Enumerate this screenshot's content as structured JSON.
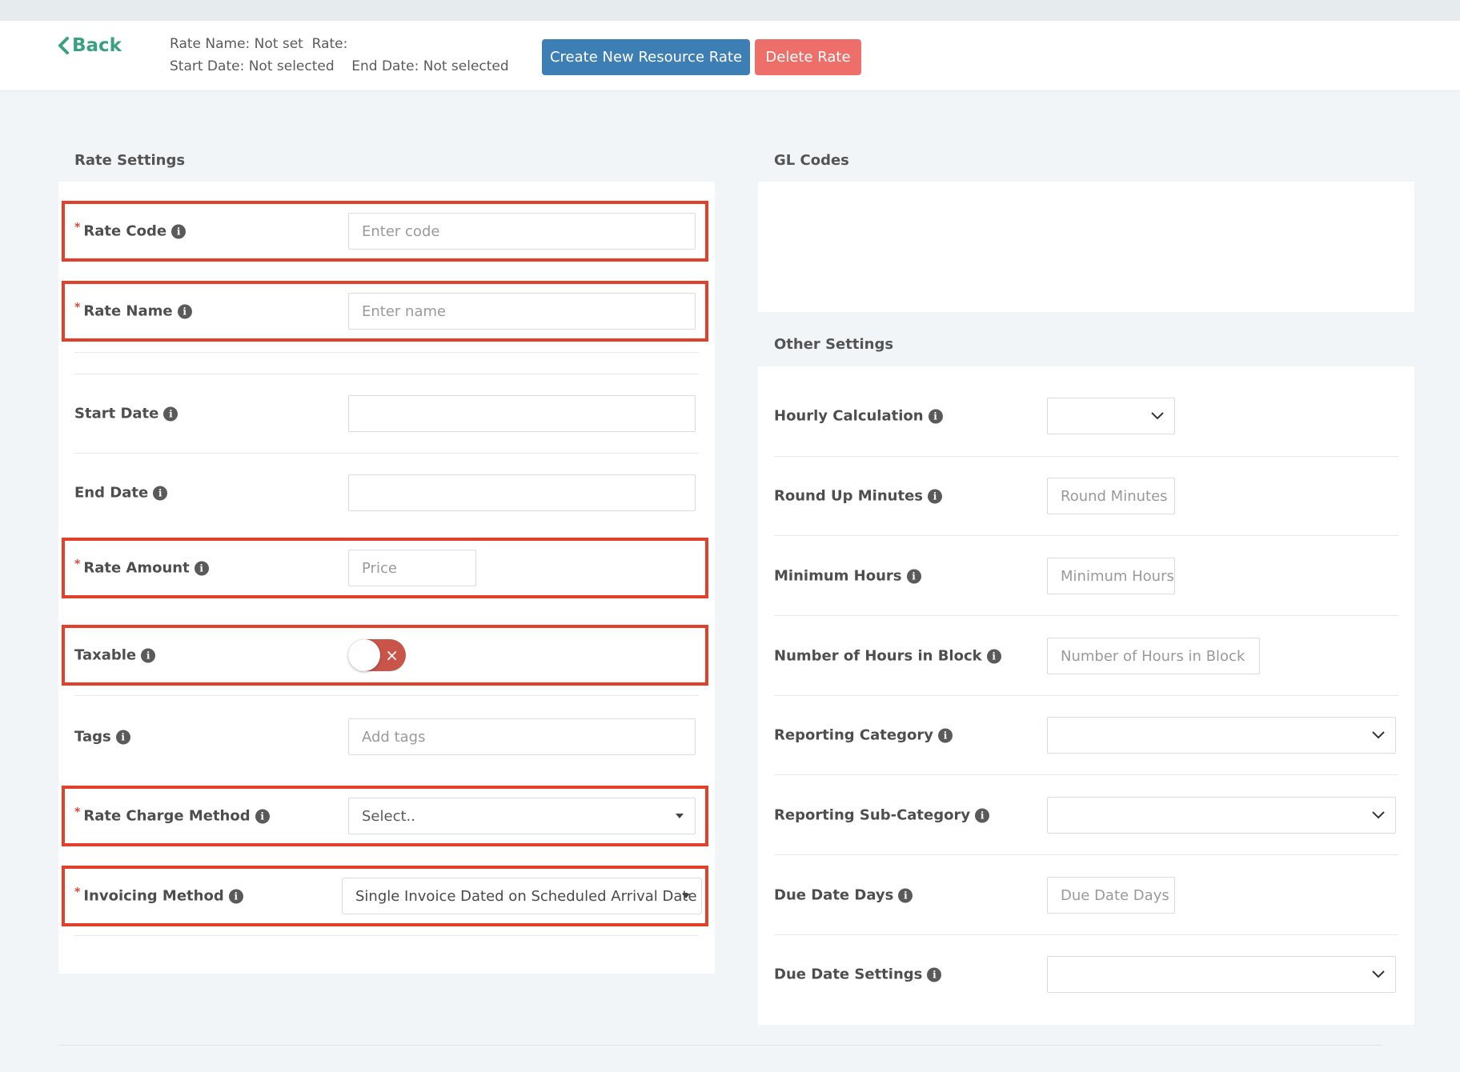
{
  "header": {
    "back_label": "Back",
    "meta_line1": "Rate Name: Not set  Rate:",
    "meta_line2": "Start Date: Not selected    End Date: Not selected",
    "create_button": "Create New Resource Rate",
    "delete_button": "Delete Rate"
  },
  "rate_settings": {
    "title": "Rate Settings",
    "rate_code": {
      "label": "Rate Code",
      "placeholder": "Enter code"
    },
    "rate_name": {
      "label": "Rate Name",
      "placeholder": "Enter name"
    },
    "start_date": {
      "label": "Start Date",
      "value": ""
    },
    "end_date": {
      "label": "End Date",
      "value": ""
    },
    "rate_amount": {
      "label": "Rate Amount",
      "placeholder": "Price"
    },
    "taxable": {
      "label": "Taxable",
      "state": "off",
      "off_glyph": "×"
    },
    "tags": {
      "label": "Tags",
      "placeholder": "Add tags"
    },
    "rate_charge_method": {
      "label": "Rate Charge Method",
      "value": "Select.."
    },
    "invoicing_method": {
      "label": "Invoicing Method",
      "value": "Single Invoice Dated on Scheduled Arrival Date"
    }
  },
  "gl_codes": {
    "title": "GL Codes"
  },
  "other_settings": {
    "title": "Other Settings",
    "hourly_calculation": {
      "label": "Hourly Calculation",
      "value": ""
    },
    "round_up_minutes": {
      "label": "Round Up Minutes",
      "placeholder": "Round Minutes"
    },
    "minimum_hours": {
      "label": "Minimum Hours",
      "placeholder": "Minimum Hours"
    },
    "hours_in_block": {
      "label": "Number of Hours in Block",
      "placeholder": "Number of Hours in Block"
    },
    "reporting_category": {
      "label": "Reporting Category",
      "value": ""
    },
    "reporting_sub_category": {
      "label": "Reporting Sub-Category",
      "value": ""
    },
    "due_date_days": {
      "label": "Due Date Days",
      "placeholder": "Due Date Days"
    },
    "due_date_settings": {
      "label": "Due Date Settings",
      "value": ""
    }
  },
  "icons": {
    "info": "info-icon",
    "back": "chevron-left-icon",
    "dropdown": "chevron-down-icon",
    "select": "caret-down-icon"
  },
  "colors": {
    "accent_green": "#3aa083",
    "primary_blue": "#3d7fb5",
    "danger_red": "#ee6f6a",
    "required_red": "#d9473a",
    "highlight_red": "#e2402b",
    "toggle_off": "#c9544a"
  }
}
